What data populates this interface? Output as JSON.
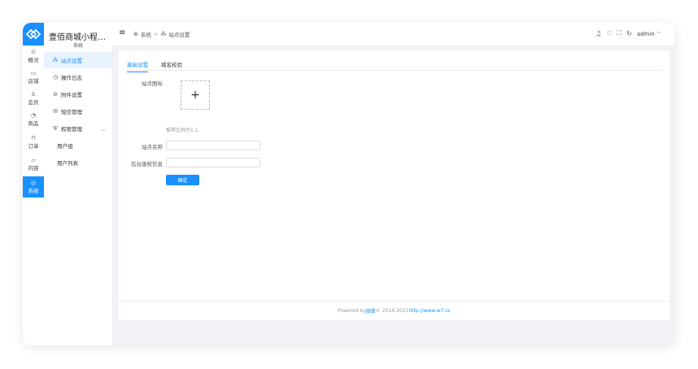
{
  "app": {
    "title": "壹佰商城小程序...",
    "section": "系统"
  },
  "rail": [
    {
      "icon": "dashboard-icon",
      "glyph": "⊙",
      "label": "概况"
    },
    {
      "icon": "store-icon",
      "glyph": "▭",
      "label": "店铺"
    },
    {
      "icon": "member-icon",
      "glyph": "♙",
      "label": "会员"
    },
    {
      "icon": "goods-icon",
      "glyph": "◔",
      "label": "商品"
    },
    {
      "icon": "order-icon",
      "glyph": "⊓",
      "label": "订单"
    },
    {
      "icon": "content-icon",
      "glyph": "▱",
      "label": "内容"
    },
    {
      "icon": "system-icon",
      "glyph": "◎",
      "label": "系统"
    }
  ],
  "sidebar": {
    "items": [
      {
        "icon": "site-icon",
        "glyph": "⁂",
        "label": "站点设置"
      },
      {
        "icon": "log-icon",
        "glyph": "◷",
        "label": "操作日志"
      },
      {
        "icon": "attachment-icon",
        "glyph": "⊘",
        "label": "附件设置"
      },
      {
        "icon": "sms-icon",
        "glyph": "✉",
        "label": "短信管理"
      },
      {
        "icon": "permission-icon",
        "glyph": "⛨",
        "label": "权限管理"
      }
    ],
    "subitems": [
      "用户组",
      "用户列表"
    ]
  },
  "topbar": {
    "breadcrumb": [
      "系统",
      "站点设置"
    ],
    "breadcrumb_sep": ">",
    "user": "admin",
    "user_arrow": "﹀"
  },
  "tabs": [
    "基础设置",
    "域名校验"
  ],
  "form": {
    "icon_label": "站点图标",
    "upload_plus": "+",
    "upload_hint": "推荐比例为1:1",
    "name_label": "站点名称",
    "name_value": "",
    "copyright_label": "后台版权信息",
    "copyright_value": "",
    "confirm_label": "确定"
  },
  "footer": {
    "prefix": "Powered by",
    "brand": "微擎",
    "middle": "© 2014-2021",
    "link": "http://www.w7.cc"
  },
  "colors": {
    "accent": "#1890ff",
    "background": "#f0f2f5"
  }
}
